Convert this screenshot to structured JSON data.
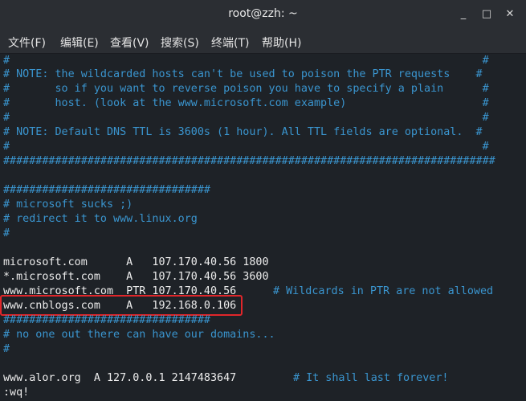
{
  "window": {
    "title": "root@zzh: ~"
  },
  "menu": [
    {
      "label": "文件(F)"
    },
    {
      "label": "编辑(E)"
    },
    {
      "label": "查看(V)"
    },
    {
      "label": "搜索(S)"
    },
    {
      "label": "终端(T)"
    },
    {
      "label": "帮助(H)"
    }
  ],
  "terminal": {
    "lines": [
      "#                                                                         #",
      "# NOTE: the wildcarded hosts can't be used to poison the PTR requests    #",
      "#       so if you want to reverse poison you have to specify a plain      #",
      "#       host. (look at the www.microsoft.com example)                     #",
      "#                                                                         #",
      "# NOTE: Default DNS TTL is 3600s (1 hour). All TTL fields are optional.  #",
      "#                                                                         #",
      "############################################################################",
      "",
      "################################",
      "# microsoft sucks ;)",
      "# redirect it to www.linux.org",
      "#",
      "",
      "microsoft.com      A   107.170.40.56 1800",
      "*.microsoft.com    A   107.170.40.56 3600",
      "www.microsoft.com  PTR 107.170.40.56",
      "www.cnblogs.com    A   192.168.0.106",
      "################################",
      "# no one out there can have our domains...",
      "#",
      "",
      "www.alor.org  A 127.0.0.1 2147483647",
      ":wq!"
    ],
    "ptr_comment": "# Wildcards in PTR are not allowed",
    "alor_comment": "# It shall last forever!"
  }
}
